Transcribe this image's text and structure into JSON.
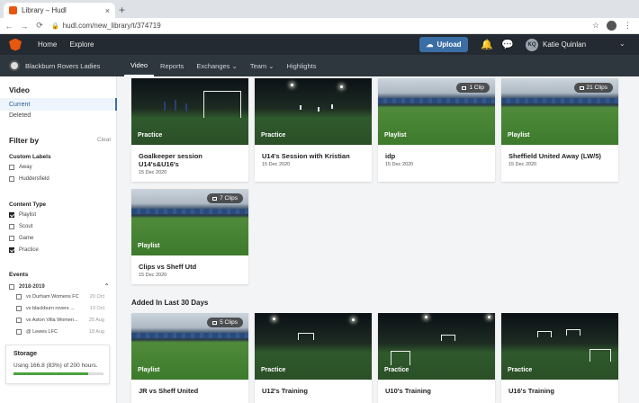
{
  "browser": {
    "tab_title": "Library – Hudl",
    "tab_close": "×",
    "new_tab": "+",
    "url": "hudl.com/new_library/t/374719"
  },
  "header": {
    "home": "Home",
    "explore": "Explore",
    "upload": "Upload",
    "user_initials": "KQ",
    "user_name": "Katie Quinlan"
  },
  "teambar": {
    "team_name": "Blackburn Rovers Ladies",
    "tabs": [
      "Video",
      "Reports",
      "Exchanges",
      "Team",
      "Highlights"
    ]
  },
  "sidebar": {
    "video_heading": "Video",
    "current": "Current",
    "deleted": "Deleted",
    "filter_by": "Filter by",
    "clear": "Clear",
    "custom_labels": "Custom Labels",
    "labels": [
      "Away",
      "Huddersfield"
    ],
    "content_type": "Content Type",
    "content_types": [
      {
        "label": "Playlist",
        "checked": true
      },
      {
        "label": "Scout",
        "checked": false
      },
      {
        "label": "Game",
        "checked": false
      },
      {
        "label": "Practice",
        "checked": true
      }
    ],
    "events": "Events",
    "season": "2018-2019",
    "event_items": [
      {
        "label": "vs Durham Womens FC",
        "date": "20 Oct"
      },
      {
        "label": "vs blackburn rovers ...",
        "date": "13 Oct"
      },
      {
        "label": "vs Aston Villa Women...",
        "date": "25 Aug"
      },
      {
        "label": "@ Lewes LFC",
        "date": "18 Aug"
      }
    ],
    "storage_title": "Storage",
    "storage_text": "Using 166.8 (83%) of 200 hours.",
    "storage_fraction": 0.83
  },
  "main": {
    "cards_top": [
      {
        "title": "Goalkeeper session U14's&U16's",
        "date": "15 Dec 2020",
        "type": "Practice",
        "clips": ""
      },
      {
        "title": "U14's Session with Kristian",
        "date": "15 Dec 2020",
        "type": "Practice",
        "clips": ""
      },
      {
        "title": "idp",
        "date": "15 Dec 2020",
        "type": "Playlist",
        "clips": "1 Clip"
      },
      {
        "title": "Sheffield United Away (LW/5)",
        "date": "15 Dec 2020",
        "type": "Playlist",
        "clips": "21 Clips"
      },
      {
        "title": "Clips vs Sheff Utd",
        "date": "15 Dec 2020",
        "type": "Playlist",
        "clips": "7 Clips"
      }
    ],
    "section_title": "Added In Last 30 Days",
    "cards_recent": [
      {
        "title": "JR vs Sheff United",
        "type": "Playlist",
        "clips": "5 Clips"
      },
      {
        "title": "U12's Training",
        "type": "Practice",
        "clips": ""
      },
      {
        "title": "U10's Training",
        "type": "Practice",
        "clips": ""
      },
      {
        "title": "U16's Training",
        "type": "Practice",
        "clips": ""
      }
    ]
  },
  "colors": {
    "brand_orange": "#e8560f",
    "header_dark": "#232a31",
    "upload_blue": "#3a6ea5",
    "storage_green": "#4aa33b"
  }
}
